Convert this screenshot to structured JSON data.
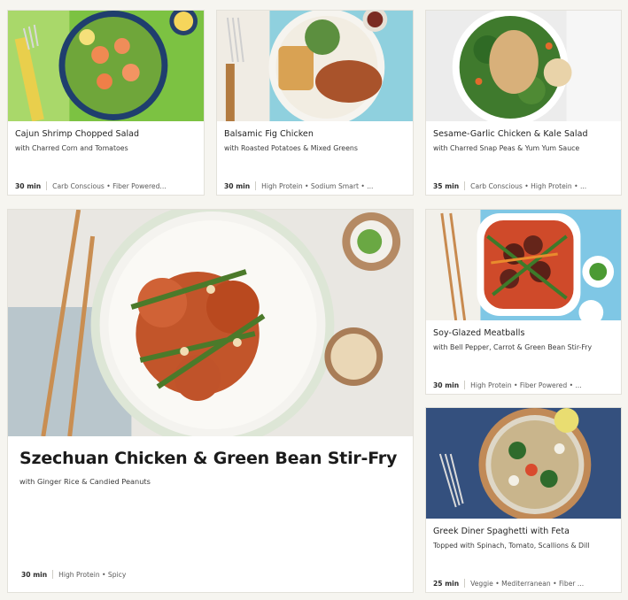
{
  "cards": [
    {
      "title": "Cajun Shrimp Chopped Salad",
      "subtitle": "with Charred Corn and Tomatoes",
      "time": "30 min",
      "tags": "Carb Conscious • Fiber Powered...",
      "image_icon": "shrimp-salad-photo"
    },
    {
      "title": "Balsamic Fig Chicken",
      "subtitle": "with Roasted Potatoes & Mixed Greens",
      "time": "30 min",
      "tags": "High Protein • Sodium Smart • ...",
      "image_icon": "fig-chicken-photo"
    },
    {
      "title": "Sesame-Garlic Chicken & Kale Salad",
      "subtitle": "with Charred Snap Peas & Yum Yum Sauce",
      "time": "35 min",
      "tags": "Carb Conscious • High Protein • ...",
      "image_icon": "kale-salad-photo"
    },
    {
      "title": "Szechuan Chicken & Green Bean Stir-Fry",
      "subtitle": "with Ginger Rice & Candied Peanuts",
      "time": "30 min",
      "tags": "High Protein • Spicy",
      "image_icon": "stir-fry-photo"
    },
    {
      "title": "Soy-Glazed Meatballs",
      "subtitle": "with Bell Pepper, Carrot & Green Bean Stir-Fry",
      "time": "30 min",
      "tags": "High Protein • Fiber Powered • ...",
      "image_icon": "meatballs-photo"
    },
    {
      "title": "Greek Diner Spaghetti with Feta",
      "subtitle": "Topped with Spinach, Tomato, Scallions & Dill",
      "time": "25 min",
      "tags": "Veggie • Mediterranean • Fiber ...",
      "image_icon": "spaghetti-photo"
    }
  ],
  "colors": {
    "page_bg": "#f6f5f0",
    "card_bg": "#ffffff",
    "card_border": "#e3e1da"
  }
}
